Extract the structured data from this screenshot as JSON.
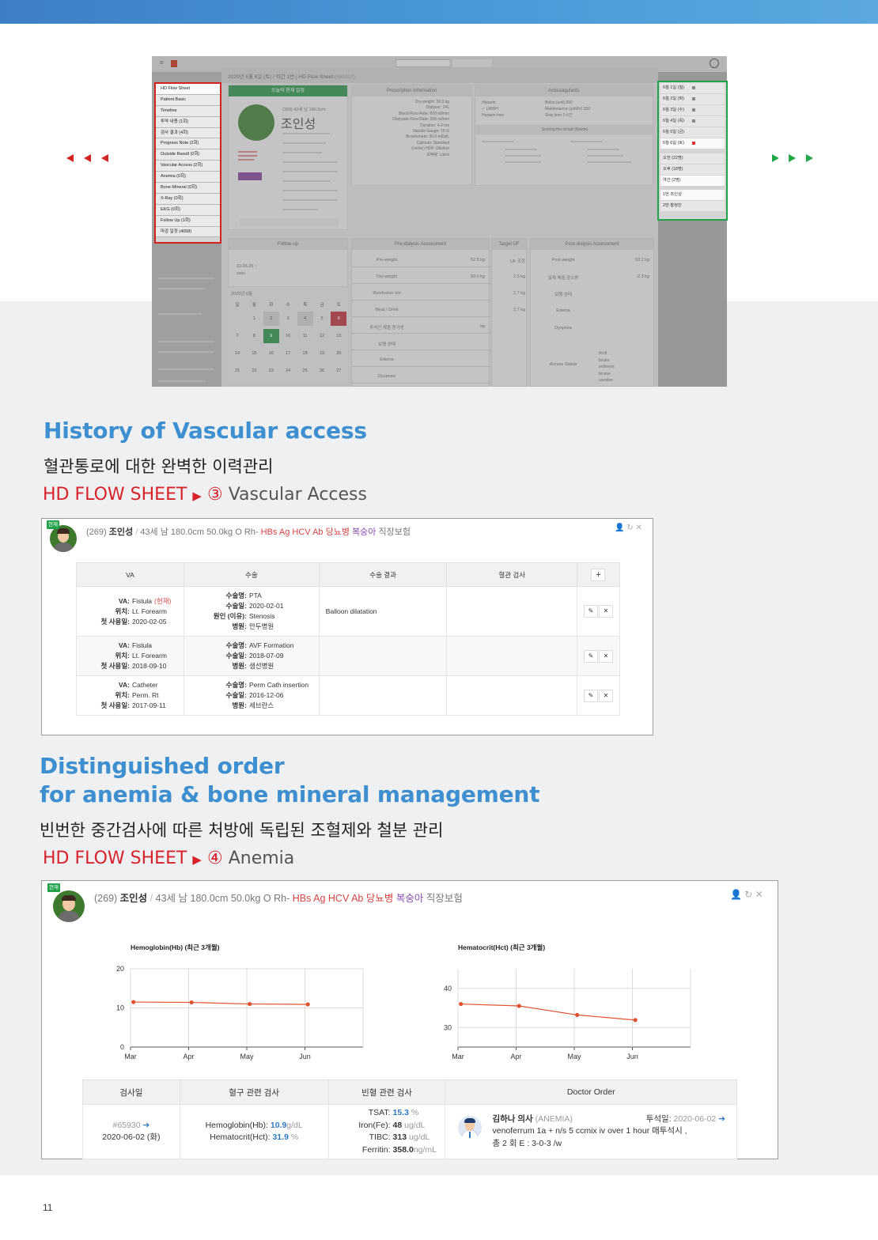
{
  "sec1": {
    "title": "History of Vascular access",
    "subtitle": "혈관통로에 대한 완벽한 이력관리",
    "crumb_prefix": "HD FLOW SHEET",
    "crumb_arrow": "▶",
    "crumb_num": "③",
    "crumb_name": "Vascular Access"
  },
  "sec2": {
    "title1": "Distinguished order",
    "title2": "for anemia & bone mineral management",
    "subtitle": "빈번한 중간검사에 따른 처방에 독립된 조혈제와 철분 관리",
    "crumb_prefix": "HD FLOW SHEET",
    "crumb_arrow": "▶",
    "crumb_num": "④",
    "crumb_name": "Anemia"
  },
  "screenshot": {
    "modal_title": "2020년 6월 6일 (토) / 야간 1번 | HD Flow Sheet",
    "modal_id": "(#66217)",
    "schedule_head": "오늘의 현재 일정",
    "patient_name": "조인성",
    "patient_meta": "(269) 43세 남 180.0cm",
    "prescription_head": "Prescription Information",
    "anticoag_head": "Anticoagulants",
    "predialysis_head": "Pre-dialysis Assessment",
    "target_uf_head": "Target UF",
    "postdialysis_head": "Post-dialysis Assessment",
    "followup_head": "Follow-up",
    "calendar_month": "2020년 6월",
    "circuit_head": "Scoring the circuit (Grade)",
    "prescription_rows": [
      "Dry-weight: 50.0 kg",
      "Dialyser: 14L",
      "Blood Flow Rate: 600 ml/min",
      "Dialysate Flow Rate: 300 ml/min",
      "Duration: 4.0 hrs",
      "Needle Gauge: 16 G",
      "Bicarbonate: 30.0 mEq/L",
      "Calcium: Standard",
      "(online) HDF: Dilution",
      "보액량: Liters"
    ],
    "anticoag_rows": [
      "Heparin",
      "✓ LMWH",
      "Heparin-free"
    ],
    "anticoag_values": [
      "Bolus (unit)  600",
      "Maintenance (unit/hr)  200",
      "Stop time  1시간"
    ],
    "pre_rows": [
      "Pre-weight",
      "Dry-weight",
      "Reinfusion Vol",
      "Meal / Drink",
      "투석간 체중 증가량",
      "보행 상태",
      "Edema",
      "Dyspnea"
    ],
    "pre_values": [
      "52.5 kg",
      "50.0 kg",
      "",
      "",
      "kg",
      "",
      "",
      ""
    ],
    "uf_values": [
      "UF 조정",
      "2.5 kg",
      "2.7 kg",
      "2.7 kg"
    ],
    "post_rows": [
      "Post-weight",
      "실제 체중 감소량",
      "보행 상태",
      "Edema",
      "Dyspnea",
      "Access Status"
    ],
    "post_values": [
      "50.2 kg",
      "-2.3 kg"
    ],
    "access_status": [
      "thrill",
      "bruits",
      "redness",
      "bruise",
      "swollen"
    ],
    "followup_item": "19.06.25 ~",
    "followup_note": "ssss",
    "calendar_days": [
      "일",
      "월",
      "화",
      "수",
      "목",
      "금",
      "토"
    ],
    "calendar_dates": [
      "",
      "1",
      "2",
      "3",
      "4",
      "5",
      "6",
      "7",
      "8",
      "9",
      "10",
      "11",
      "12",
      "13",
      "14",
      "15",
      "16",
      "17",
      "18",
      "19",
      "20",
      "21",
      "22",
      "23",
      "24",
      "25",
      "26",
      "27"
    ],
    "left_menu": [
      "HD Flow Sheet",
      "Patient Basic",
      "Timeline",
      "투약 내용 (1회)",
      "검사 결과 (4회)",
      "Progress Note (2회)",
      "Outside Result (0회)",
      "Vascular Access (2회)",
      "Anemia (0회)",
      "Bone-Mineral (0회)",
      "X-Ray (0회)",
      "EKG (0회)",
      "Follow Up (1회)",
      "마감 일정 (4058)"
    ],
    "date_list": [
      {
        "label": "6월 1일 (월)",
        "mark": "gray",
        "style": "gray"
      },
      {
        "label": "6월 2일 (화)",
        "mark": "gray",
        "style": "gray"
      },
      {
        "label": "6월 3일 (수)",
        "mark": "gray",
        "style": "gray"
      },
      {
        "label": "6월 4일 (목)",
        "mark": "gray",
        "style": "gray"
      },
      {
        "label": "6월 5일 (금)",
        "mark": "",
        "style": "gray"
      },
      {
        "label": "6월 6일 (토)",
        "mark": "red",
        "style": "white"
      },
      {
        "label": "오전 (22명)",
        "mark": "",
        "style": "gray"
      },
      {
        "label": "오후 (18명)",
        "mark": "",
        "style": "gray"
      },
      {
        "label": "야간 (2명)",
        "mark": "",
        "style": "white"
      },
      {
        "label": "1번 조인성",
        "mark": "",
        "style": "white"
      },
      {
        "label": "2번 황정민",
        "mark": "",
        "style": "gray"
      }
    ]
  },
  "va_card": {
    "badge": "현재",
    "pid": "(269)",
    "name": "조인성",
    "sep": "/",
    "demo": "43세 남 180.0cm 50.0kg O Rh-",
    "tag1": "HBs Ag",
    "tag2": "HCV Ab",
    "tag3": "당뇨병",
    "tag4": "복숭아",
    "insurance": "직장보험",
    "icons": "👤 ↻ ✕",
    "headers": [
      "VA",
      "수술",
      "수술 결과",
      "혈관 검사",
      "+"
    ],
    "rows": [
      {
        "va": [
          [
            "VA:",
            "Fistula"
          ],
          [
            "위치:",
            "Lt. Forearm"
          ],
          [
            "첫 사용일:",
            "2020-02-05"
          ]
        ],
        "va_current": "(현재)",
        "op": [
          [
            "수술명:",
            "PTA"
          ],
          [
            "수술일:",
            "2020-02-01"
          ],
          [
            "원인 (이유):",
            "Stenosis"
          ],
          [
            "병원:",
            "만두병원"
          ]
        ],
        "result": "Balloon dilatation",
        "vessel": ""
      },
      {
        "va": [
          [
            "VA:",
            "Fistula"
          ],
          [
            "위치:",
            "Lt. Forearm"
          ],
          [
            "첫 사용일:",
            "2018-09-10"
          ]
        ],
        "va_current": "",
        "op": [
          [
            "수술명:",
            "AVF Formation"
          ],
          [
            "수술일:",
            "2018-07-09"
          ],
          [
            "병원:",
            "샘선병원"
          ]
        ],
        "result": "",
        "vessel": ""
      },
      {
        "va": [
          [
            "VA:",
            "Catheter"
          ],
          [
            "위치:",
            "Perm. Rt"
          ],
          [
            "첫 사용일:",
            "2017-09-11"
          ]
        ],
        "va_current": "",
        "op": [
          [
            "수술명:",
            "Perm Cath insertion"
          ],
          [
            "수술일:",
            "2016-12-06"
          ],
          [
            "병원:",
            "세브란스"
          ]
        ],
        "result": "",
        "vessel": ""
      }
    ],
    "edit_icon": "✎",
    "delete_icon": "✕"
  },
  "an_card": {
    "badge": "현재",
    "pid": "(269)",
    "name": "조인성",
    "sep": "/",
    "demo": "43세 남 180.0cm 50.0kg O Rh-",
    "tag1": "HBs Ag",
    "tag2": "HCV Ab",
    "tag3": "당뇨병",
    "tag4": "복숭아",
    "insurance": "직장보험",
    "icons": "👤 ↻ ✕",
    "table_headers": [
      "검사일",
      "혈구 관련 검사",
      "빈혈 관련 검사",
      "Doctor Order"
    ],
    "exam_no": "#65930",
    "exam_date": "2020-06-02 (화)",
    "hb_label": "Hemoglobin(Hb):",
    "hb_value": "10.9",
    "hb_unit": "g/dL",
    "hct_label": "Hematocrit(Hct):",
    "hct_value": "31.9",
    "hct_unit": "%",
    "tsat_label": "TSAT:",
    "tsat_value": "15.3",
    "tsat_unit": "%",
    "iron_label": "Iron(Fe):",
    "iron_value": "48",
    "iron_unit": "ug/dL",
    "tibc_label": "TIBC:",
    "tibc_value": "313",
    "tibc_unit": "ug/dL",
    "ferritin_label": "Ferritin:",
    "ferritin_value": "358.0",
    "ferritin_unit": "ng/mL",
    "doctor": "김하나 의사",
    "doctor_tag": "(ANEMIA)",
    "dialysis_date_label": "투석일:",
    "dialysis_date": "2020-06-02",
    "order_line1": "venoferrum 1a + n/s 5 ccmix iv over 1 hour 매투석시 ,",
    "order_line2": "총 2 회 E : 3-0-3 /w"
  },
  "chart_data": [
    {
      "type": "line",
      "title": "Hemoglobin(Hb) (최근 3개월)",
      "x": [
        "Mar",
        "Apr",
        "May",
        "Jun"
      ],
      "series": [
        {
          "values": [
            11.5,
            11.4,
            11.0,
            10.9
          ]
        }
      ],
      "ylim": [
        0,
        20
      ],
      "yticks": [
        0,
        10,
        20
      ],
      "grid": true,
      "color": "#e0522e"
    },
    {
      "type": "line",
      "title": "Hematocrit(Hct) (최근 3개월)",
      "x": [
        "Mar",
        "Apr",
        "May",
        "Jun"
      ],
      "series": [
        {
          "values": [
            36.0,
            35.5,
            33.2,
            31.9
          ]
        }
      ],
      "ylim": [
        25,
        45
      ],
      "yticks": [
        30,
        40
      ],
      "grid": true,
      "color": "#e0522e"
    }
  ],
  "page_number": "11"
}
